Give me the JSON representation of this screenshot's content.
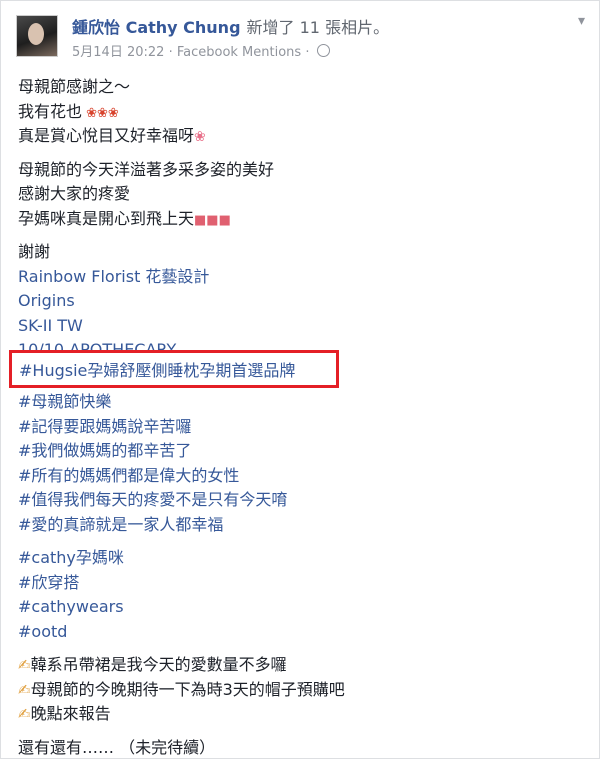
{
  "post": {
    "author": "鍾欣怡 Cathy Chung",
    "action": "新增了 11 張相片。",
    "date": "5月14日 20:22",
    "separator": "·",
    "via": "Facebook Mentions",
    "privacy_icon": "globe-icon",
    "menu_icon": "chevron-down-icon"
  },
  "body": {
    "block1": [
      "母親節感謝之～",
      "我有花也",
      "真是賞心悅目又好幸福呀"
    ],
    "block2": [
      "母親節的今天洋溢著多采多姿的美好",
      "感謝大家的疼愛",
      "孕媽咪真是開心到飛上天"
    ],
    "thanks_label": "謝謝",
    "brands": [
      "Rainbow Florist 花藝設計",
      "Origins",
      "SK-II TW",
      "10/10 APOTHECARY"
    ],
    "highlighted_tag": "#Hugsie孕婦舒壓側睡枕孕期首選品牌",
    "tags1": [
      "#母親節快樂",
      "#記得要跟媽媽說辛苦囉",
      "#我們做媽媽的都辛苦了",
      "#所有的媽媽們都是偉大的女性",
      "#值得我們每天的疼愛不是只有今天唷",
      "#愛的真諦就是一家人都幸福"
    ],
    "tags2": [
      "#cathy孕媽咪",
      "#欣穿搭",
      "#cathywears",
      "#ootd"
    ],
    "notes": [
      "韓系吊帶裙是我今天的愛數量不多囉",
      "母親節的今晚期待一下為時3天的帽子預購吧",
      "晚點來報告"
    ],
    "ending": "還有還有…… （未完待續）"
  },
  "colors": {
    "link": "#365899",
    "highlight_border": "#e41f26",
    "meta": "#90949c"
  }
}
